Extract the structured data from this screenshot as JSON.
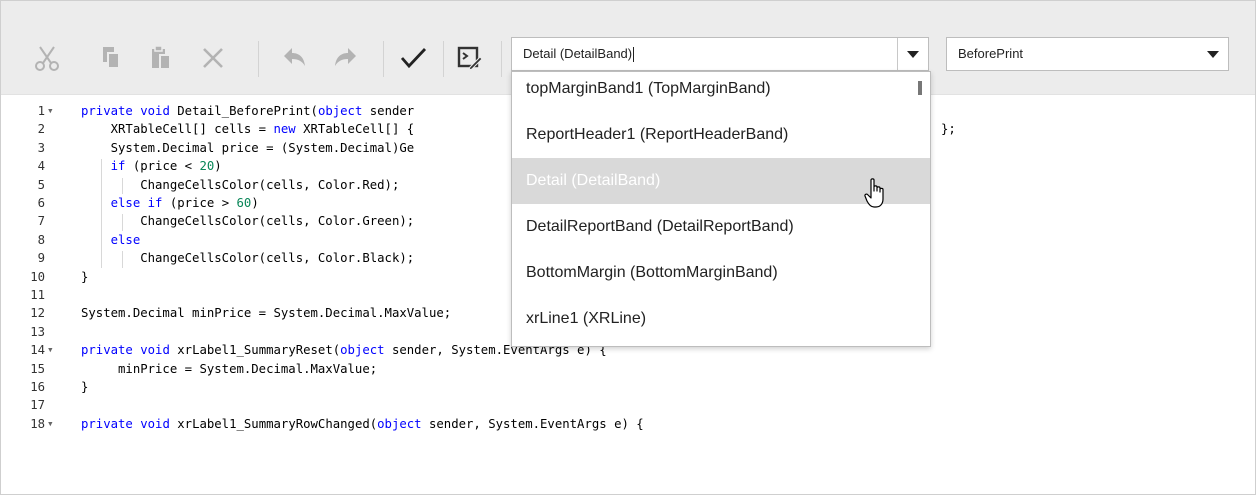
{
  "toolbar": {
    "buttons": [
      {
        "name": "cut-icon",
        "enabled": false
      },
      {
        "name": "copy-icon",
        "enabled": false
      },
      {
        "name": "paste-icon",
        "enabled": false
      },
      {
        "name": "delete-icon",
        "enabled": false
      },
      {
        "name": "undo-icon",
        "enabled": false
      },
      {
        "name": "redo-icon",
        "enabled": false
      },
      {
        "name": "checkmark-icon",
        "enabled": true
      },
      {
        "name": "script-edit-icon",
        "enabled": true
      }
    ]
  },
  "band_combo": {
    "value": "Detail (DetailBand)"
  },
  "event_combo": {
    "value": "BeforePrint"
  },
  "dropdown": {
    "items": [
      "topMarginBand1 (TopMarginBand)",
      "ReportHeader1 (ReportHeaderBand)",
      "Detail (DetailBand)",
      "DetailReportBand (DetailReportBand)",
      "BottomMargin (BottomMarginBand)",
      "xrLine1 (XRLine)"
    ],
    "selected_index": 2
  },
  "code": {
    "line_numbers": [
      "1",
      "2",
      "3",
      "4",
      "5",
      "6",
      "7",
      "8",
      "9",
      "10",
      "11",
      "12",
      "13",
      "14",
      "15",
      "16",
      "17",
      "18"
    ],
    "lines": [
      "private void Detail_BeforePrint(object sender",
      "    XRTableCell[] cells = new XRTableCell[] {",
      "    System.Decimal price = (System.Decimal)Ge",
      "    if (price < 20)",
      "        ChangeCellsColor(cells, Color.Red);",
      "    else if (price > 60)",
      "        ChangeCellsColor(cells, Color.Green);",
      "    else",
      "        ChangeCellsColor(cells, Color.Black);",
      "}",
      "",
      "System.Decimal minPrice = System.Decimal.MaxValue;",
      "",
      "private void xrLabel1_SummaryReset(object sender, System.EventArgs e) {",
      "     minPrice = System.Decimal.MaxValue;",
      "}",
      "",
      "private void xrLabel1_SummaryRowChanged(object sender, System.EventArgs e) {"
    ],
    "line2_tail": "};",
    "fold_markers": [
      "1",
      "14",
      "18"
    ]
  }
}
